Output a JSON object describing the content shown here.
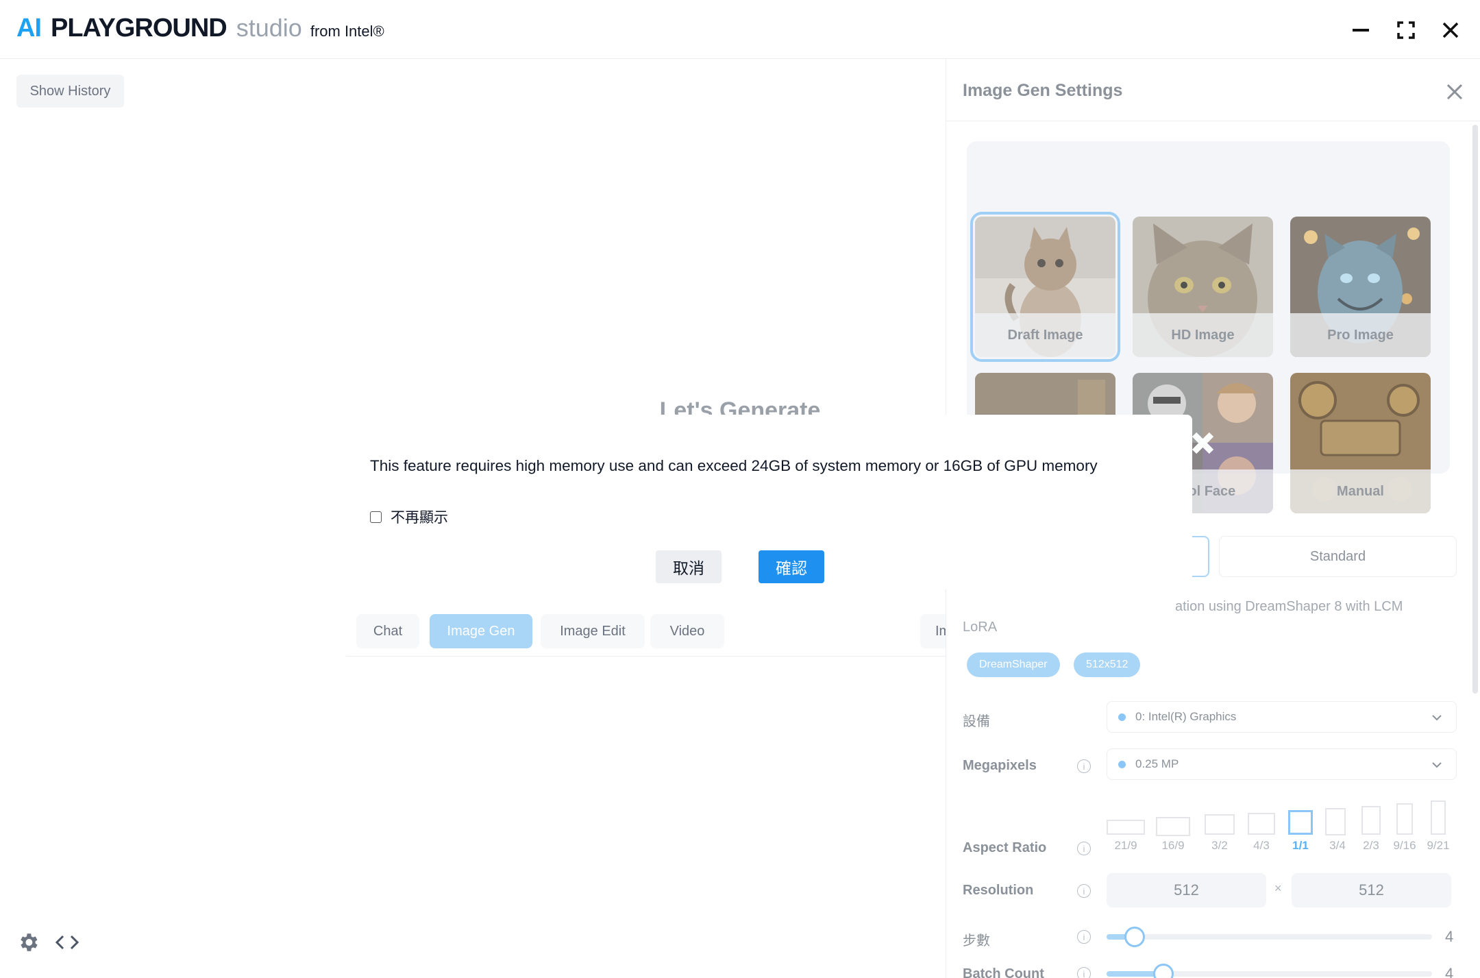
{
  "app": {
    "brand_ai": "AI",
    "brand_playground": "PLAYGROUND",
    "brand_studio": "studio",
    "brand_from": "from Intel®"
  },
  "main": {
    "show_history": "Show History",
    "heading": "Let's Generate",
    "tabs": [
      "Chat",
      "Image Gen",
      "Image Edit",
      "Video",
      "Im"
    ],
    "active_tab": "Image Gen"
  },
  "panel": {
    "title": "Image Gen Settings",
    "presets": [
      {
        "label": "Draft Image",
        "selected": true
      },
      {
        "label": "HD Image",
        "selected": false
      },
      {
        "label": "Pro Image",
        "selected": false
      },
      {
        "label": "",
        "selected": false
      },
      {
        "label": "ntrol Face",
        "selected": false
      },
      {
        "label": "Manual",
        "selected": false
      }
    ],
    "mode_standard": "Standard",
    "description_line1": "ation using DreamShaper 8 with LCM",
    "description_line2": "LoRA",
    "chips": [
      "DreamShaper",
      "512x512"
    ],
    "device_label": "設備",
    "device_value": "0: Intel(R) Graphics",
    "megapixels_label": "Megapixels",
    "megapixels_value": "0.25 MP",
    "aspect_label": "Aspect Ratio",
    "aspect_ratios": [
      "21/9",
      "16/9",
      "3/2",
      "4/3",
      "1/1",
      "3/4",
      "2/3",
      "9/16",
      "9/21"
    ],
    "aspect_active": "1/1",
    "resolution_label": "Resolution",
    "resolution_width": "512",
    "resolution_height": "512",
    "resolution_sep": "×",
    "steps_label": "步數",
    "steps_value": "4",
    "steps_level": 0.06,
    "batch_label": "Batch Count",
    "batch_value": "4",
    "info_glyph": "i"
  },
  "dialog": {
    "message": "This feature requires high memory use and can exceed 24GB of system memory or 16GB of GPU memory",
    "dont_show": "不再顯示",
    "cancel": "取消",
    "confirm": "確認"
  },
  "colors": {
    "accent": "#1e90f0",
    "brand_blue": "#1da1f2",
    "selected_light": "#a9d5f7"
  },
  "icons": [
    "minimize-icon",
    "maximize-icon",
    "close-icon",
    "panel-close-icon",
    "settings-gear-icon",
    "code-icon",
    "chevron-down-icon",
    "info-icon"
  ]
}
